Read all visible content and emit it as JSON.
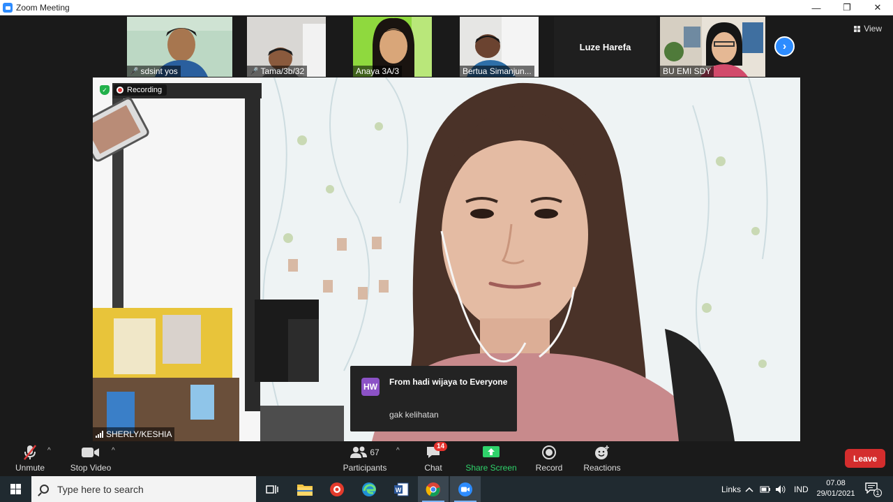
{
  "window": {
    "title": "Zoom Meeting",
    "minimize_glyph": "—",
    "restore_glyph": "❐",
    "close_glyph": "✕"
  },
  "gallery": {
    "participants": [
      {
        "name": "sdsint yos",
        "muted": true
      },
      {
        "name": "Tama/3b/32",
        "muted": true
      },
      {
        "name": "Anaya 3A/3",
        "muted": false
      },
      {
        "name": "Bertua Simanjun...",
        "muted": false
      },
      {
        "name": "Luze  Harefa",
        "muted": false
      },
      {
        "name": "BU EMI SDY",
        "muted": false
      }
    ],
    "view_label": "View",
    "next_glyph": "›"
  },
  "main_video": {
    "recording_label": "Recording",
    "speaker_name": "SHERLY/KESHIA"
  },
  "chat_toast": {
    "initials": "HW",
    "from": "From hadi wijaya to Everyone",
    "message": "gak kelihatan"
  },
  "toolbar": {
    "unmute": "Unmute",
    "stop_video": "Stop Video",
    "participants": "Participants",
    "participants_count": "67",
    "chat": "Chat",
    "chat_badge": "14",
    "share_screen": "Share Screen",
    "record": "Record",
    "reactions": "Reactions",
    "leave": "Leave"
  },
  "taskbar": {
    "search_placeholder": "Type here to search",
    "links": "Links",
    "lang": "IND",
    "time": "07.08",
    "date": "29/01/2021",
    "notification_count": "1"
  },
  "colors": {
    "zoom_blue": "#2d8cff",
    "share_green": "#2fd36b",
    "leave_red": "#d42d2d",
    "avatar_purple": "#8c52c6"
  }
}
